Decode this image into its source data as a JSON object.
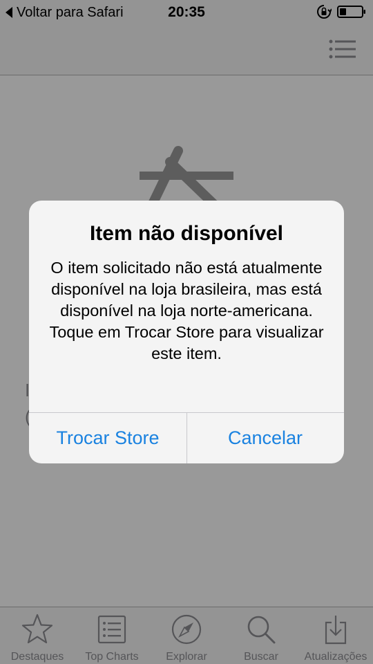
{
  "status_bar": {
    "back_label": "Voltar para Safari",
    "time": "20:35"
  },
  "background_text": {
    "fragment_1": "I",
    "fragment_2": "e",
    "fragment_3": "("
  },
  "tab_bar": {
    "items": [
      {
        "label": "Destaques",
        "icon": "star-icon"
      },
      {
        "label": "Top Charts",
        "icon": "list-icon"
      },
      {
        "label": "Explorar",
        "icon": "compass-icon"
      },
      {
        "label": "Buscar",
        "icon": "search-icon"
      },
      {
        "label": "Atualizações",
        "icon": "download-icon"
      }
    ]
  },
  "alert": {
    "title": "Item não disponível",
    "message": "O item solicitado não está atualmente disponível na loja brasileira, mas está disponível na loja norte-americana. Toque em Trocar Store para visualizar este item.",
    "primary_button": "Trocar Store",
    "cancel_button": "Cancelar"
  },
  "colors": {
    "accent": "#1a82e0",
    "tab_inactive": "#8e8e93"
  }
}
